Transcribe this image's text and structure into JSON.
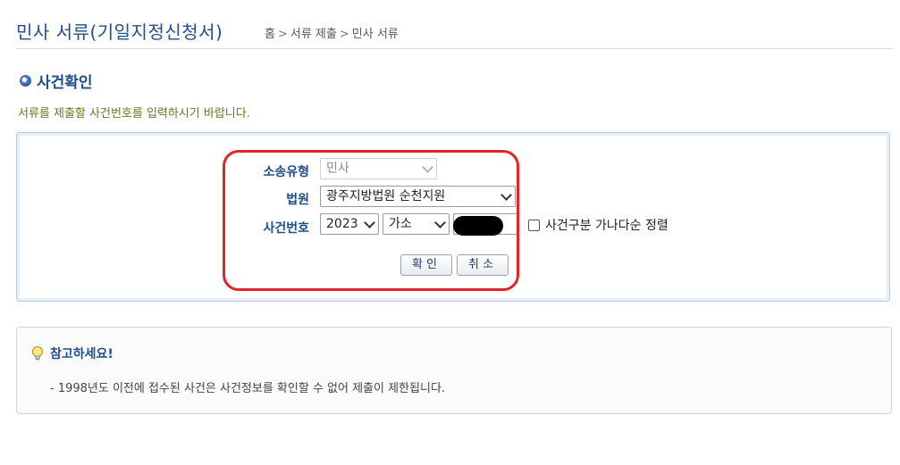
{
  "header": {
    "title": "민사 서류(기일지정신청서)",
    "breadcrumb": [
      "홈",
      "서류 제출",
      "민사 서류"
    ]
  },
  "section": {
    "title": "사건확인",
    "instruction": "서류를 제출할 사건번호를 입력하시기 바랍니다."
  },
  "form": {
    "lawsuit_type_label": "소송유형",
    "lawsuit_type_value": "민사",
    "court_label": "법원",
    "court_value": "광주지방법원 순천지원",
    "case_number_label": "사건번호",
    "case_year_value": "2023",
    "case_type_value": "가소",
    "case_number_value": "",
    "sort_checkbox_label": "사건구분 가나다순 정렬",
    "sort_checkbox_checked": false,
    "confirm_button": "확인",
    "cancel_button": "취소"
  },
  "notice": {
    "title": "참고하세요!",
    "items": [
      "- 1998년도 이전에 접수된 사건은 사건정보를 확인할 수 없어 제출이 제한됩니다."
    ]
  },
  "colors": {
    "title_blue": "#1f4e8c",
    "instruction_green": "#5e7d1b",
    "highlight_red": "#e3232b"
  }
}
